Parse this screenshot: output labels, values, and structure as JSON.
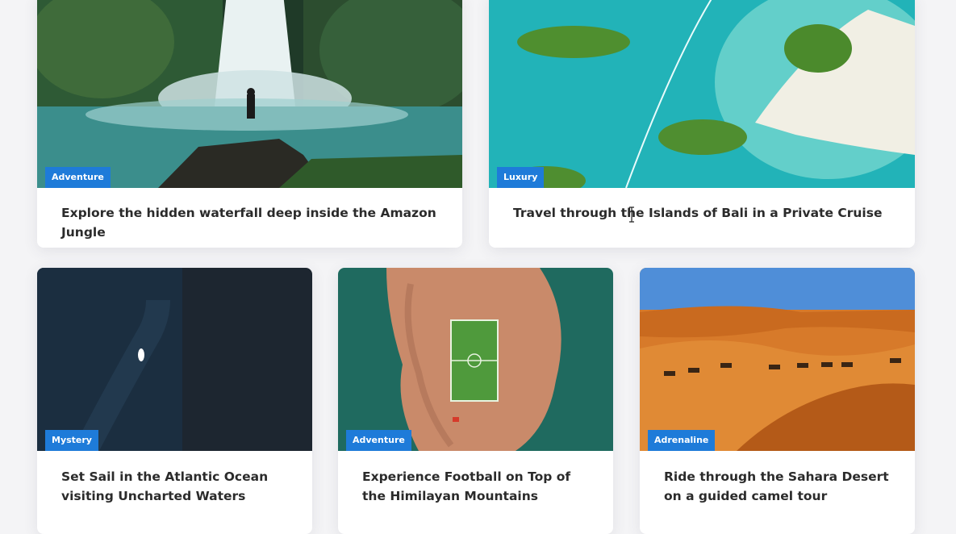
{
  "cards": [
    {
      "tag": "Adventure",
      "title": "Explore the hidden waterfall deep inside the Amazon Jungle"
    },
    {
      "tag": "Luxury",
      "title": "Travel through the Islands of Bali in a Private Cruise"
    },
    {
      "tag": "Mystery",
      "title": "Set Sail in the Atlantic Ocean visiting Uncharted Waters"
    },
    {
      "tag": "Adventure",
      "title": "Experience Football on Top of the Himilayan Mountains"
    },
    {
      "tag": "Adrenaline",
      "title": "Ride through the Sahara Desert on a guided camel tour"
    }
  ],
  "colors": {
    "badge": "#1e7bd9",
    "title": "#2b2b2b",
    "card": "#ffffff"
  }
}
